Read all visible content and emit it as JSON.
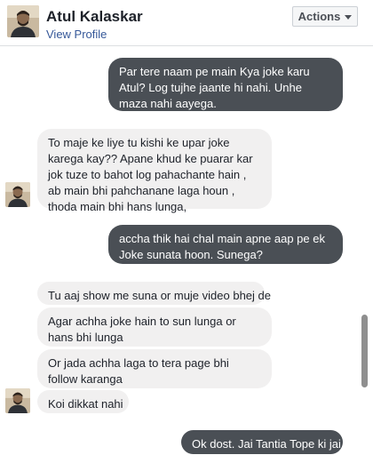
{
  "header": {
    "contact_name": "Atul Kalaskar",
    "view_profile_label": "View Profile",
    "actions_label": "Actions"
  },
  "messages": [
    {
      "direction": "outgoing",
      "text": "Par tere naam pe main Kya joke karu Atul? Log tujhe jaante hi nahi. Unhe maza nahi aayega."
    },
    {
      "direction": "incoming",
      "text": "To maje ke liye tu kishi ke upar joke karega kay?? Apane khud ke puarar kar jok tuze to bahot log pahachante hain , ab main bhi pahchanane laga houn , thoda main bhi hans lunga,"
    },
    {
      "direction": "outgoing",
      "text": "accha thik hai chal main apne aap pe ek Joke sunata hoon. Sunega?"
    },
    {
      "direction": "incoming",
      "text": "Tu aaj show me suna or muje video bhej de"
    },
    {
      "direction": "incoming",
      "text": "Agar achha joke hain to sun lunga or hans bhi lunga"
    },
    {
      "direction": "incoming",
      "text": "Or jada achha laga to tera page bhi follow karanga"
    },
    {
      "direction": "incoming",
      "text": "Koi dikkat nahi"
    },
    {
      "direction": "outgoing",
      "text": "Ok dost. Jai Tantia Tope ki jai"
    }
  ],
  "colors": {
    "outgoing_bubble": "#4a4f55",
    "incoming_bubble": "#f1f0f0",
    "link": "#365899"
  },
  "icons": {
    "avatar": "avatar-photo",
    "actions_dropdown": "caret-down-icon"
  }
}
